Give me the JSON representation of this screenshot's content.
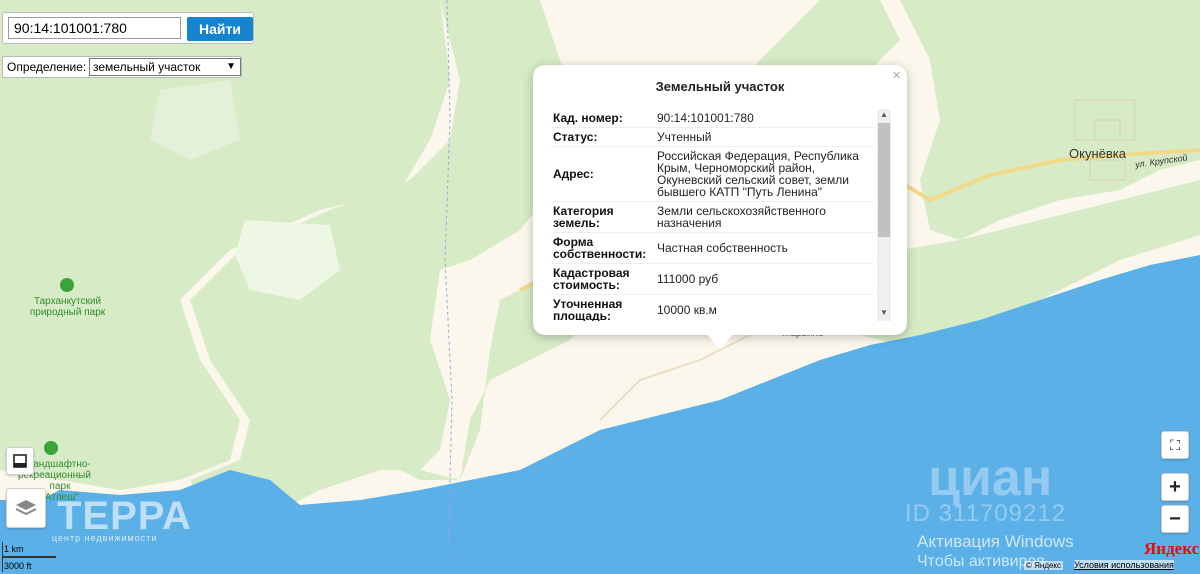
{
  "search": {
    "value": "90:14:101001:780",
    "button_label": "Найти"
  },
  "definition": {
    "label": "Определение:",
    "selected": "земельный участок"
  },
  "popup": {
    "title": "Земельный участок",
    "close": "×",
    "rows": [
      {
        "key": "Кад. номер:",
        "value": "90:14:101001:780"
      },
      {
        "key": "Статус:",
        "value": "Учтенный"
      },
      {
        "key": "Адрес:",
        "value": "Российская Федерация, Республика Крым, Черноморский район, Окуневский сельский совет, земли бывшего КАТП \"Путь Ленина\""
      },
      {
        "key": "Категория земель:",
        "value": "Земли сельскохозяйственного назначения"
      },
      {
        "key": "Форма собственности:",
        "value": "Частная собственность"
      },
      {
        "key": "Кадастровая стоимость:",
        "value": "111000 руб"
      },
      {
        "key": "Уточненная площадь:",
        "value": "10000 кв.м"
      }
    ]
  },
  "map_labels": {
    "park1": "Тарханкутский природный парк",
    "park2_line1": "андшафтно-",
    "park2_line2": "рекреационный",
    "park2_line3": "парк \"Атлеш\"",
    "town": "Окунёвка",
    "street": "ул. Крупской",
    "village": "Марьино"
  },
  "controls": {
    "fullscreen": "⛶",
    "zoom_in": "+",
    "zoom_out": "−",
    "ruler_icon": "ruler-icon",
    "layers_icon": "layers-icon"
  },
  "watermarks": {
    "cian": "циан",
    "cian_id": "ID 311709212",
    "win_line1": "Активация Windows",
    "win_line2": "Чтобы активиров...",
    "terra": "ТЕРРА",
    "terra_sub": "центр недвижимости"
  },
  "scale": {
    "km": "1 km",
    "ft": "3000 ft"
  },
  "footer": {
    "yandex": "Яндекс",
    "copyright": "© Яндекс",
    "terms": "Условия использования"
  },
  "colors": {
    "land": "#fbf7ec",
    "forest": "#d6ebc6",
    "water": "#5cb0e8",
    "road": "#f2d98a",
    "accent": "#1683ce"
  }
}
